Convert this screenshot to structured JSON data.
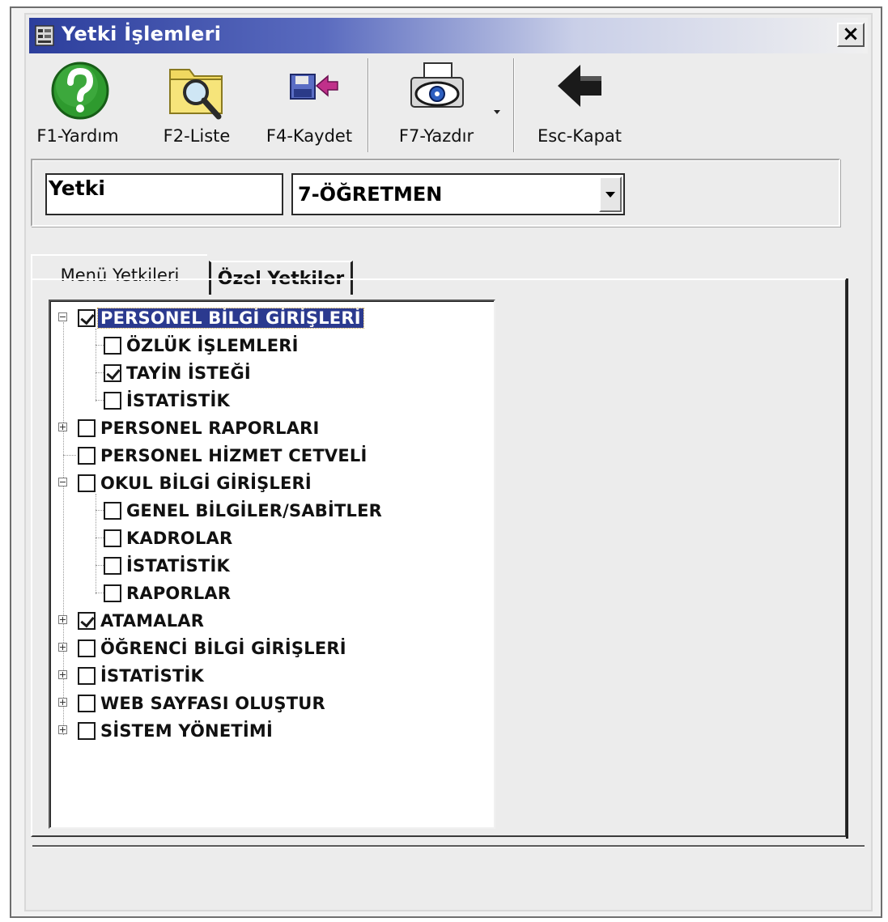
{
  "window": {
    "title": "Yetki İşlemleri",
    "close_glyph": "×"
  },
  "toolbar": {
    "buttons": [
      {
        "label": "F1-Yardım",
        "icon": "help-icon"
      },
      {
        "label": "F2-Liste",
        "icon": "folder-search-icon"
      },
      {
        "label": "F4-Kaydet",
        "icon": "save-icon"
      },
      {
        "label": "F7-Yazdır",
        "icon": "print-preview-icon"
      },
      {
        "label": "Esc-Kapat",
        "icon": "exit-arrow-icon"
      }
    ]
  },
  "permission": {
    "label": "Yetki",
    "selected_value": "7-ÖĞRETMEN"
  },
  "tabs": [
    {
      "label": "Menü Yetkileri",
      "active": true
    },
    {
      "label": "Özel Yetkiler",
      "active": false
    }
  ],
  "tree": {
    "items": [
      {
        "label": "PERSONEL BİLGİ GİRİŞLERİ",
        "checked": true,
        "level": 0,
        "expander": "minus",
        "selected": true
      },
      {
        "label": "ÖZLÜK İŞLEMLERİ",
        "checked": false,
        "level": 1,
        "expander": "none"
      },
      {
        "label": "TAYİN İSTEĞİ",
        "checked": true,
        "level": 1,
        "expander": "none"
      },
      {
        "label": "İSTATİSTİK",
        "checked": false,
        "level": 1,
        "expander": "none"
      },
      {
        "label": "PERSONEL RAPORLARI",
        "checked": false,
        "level": 0,
        "expander": "plus"
      },
      {
        "label": "PERSONEL HİZMET CETVELİ",
        "checked": false,
        "level": 0,
        "expander": "none"
      },
      {
        "label": "OKUL BİLGİ GİRİŞLERİ",
        "checked": false,
        "level": 0,
        "expander": "minus"
      },
      {
        "label": "GENEL BİLGİLER/SABİTLER",
        "checked": false,
        "level": 1,
        "expander": "none"
      },
      {
        "label": "KADROLAR",
        "checked": false,
        "level": 1,
        "expander": "none"
      },
      {
        "label": "İSTATİSTİK",
        "checked": false,
        "level": 1,
        "expander": "none"
      },
      {
        "label": "RAPORLAR",
        "checked": false,
        "level": 1,
        "expander": "none"
      },
      {
        "label": "ATAMALAR",
        "checked": true,
        "level": 0,
        "expander": "plus"
      },
      {
        "label": "ÖĞRENCİ BİLGİ GİRİŞLERİ",
        "checked": false,
        "level": 0,
        "expander": "plus"
      },
      {
        "label": "İSTATİSTİK",
        "checked": false,
        "level": 0,
        "expander": "plus"
      },
      {
        "label": "WEB SAYFASI OLUŞTUR",
        "checked": false,
        "level": 0,
        "expander": "plus"
      },
      {
        "label": "SİSTEM YÖNETİMİ",
        "checked": false,
        "level": 0,
        "expander": "plus"
      }
    ]
  },
  "colors": {
    "titlebar": "#2c3e9c",
    "selection": "#2b3a8f",
    "help_green": "#2e9a2e",
    "folder_yellow": "#f0d860"
  }
}
